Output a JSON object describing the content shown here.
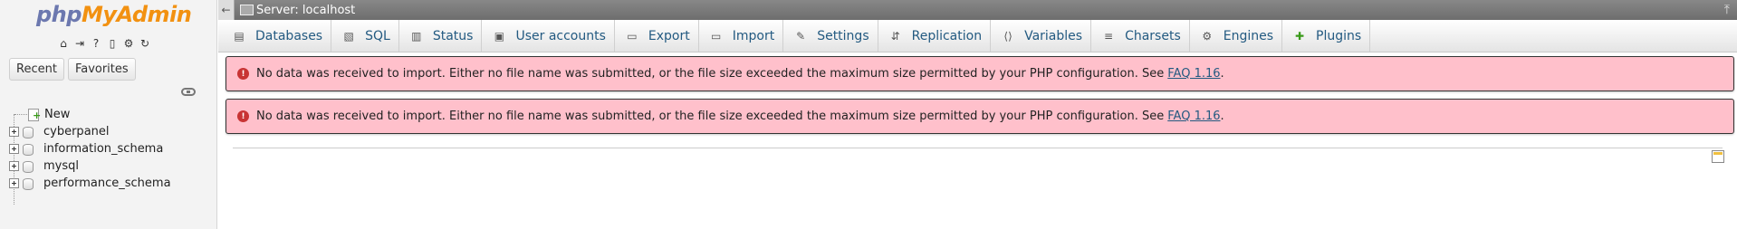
{
  "logo": {
    "php": "php",
    "my": "My",
    "admin": "Admin"
  },
  "nav_icons": [
    "home-icon",
    "logout-icon",
    "help-icon",
    "docs-icon",
    "settings-icon",
    "reload-icon"
  ],
  "nav_tabs": {
    "recent": "Recent",
    "favorites": "Favorites"
  },
  "tree": {
    "new": "New",
    "databases": [
      "cyberpanel",
      "information_schema",
      "mysql",
      "performance_schema"
    ]
  },
  "serverbar": {
    "label": "Server: localhost"
  },
  "menu": {
    "tabs": [
      {
        "label": "Databases",
        "icon": "databases-icon"
      },
      {
        "label": "SQL",
        "icon": "sql-icon"
      },
      {
        "label": "Status",
        "icon": "status-icon"
      },
      {
        "label": "User accounts",
        "icon": "user-accounts-icon"
      },
      {
        "label": "Export",
        "icon": "export-icon"
      },
      {
        "label": "Import",
        "icon": "import-icon"
      },
      {
        "label": "Settings",
        "icon": "settings-icon"
      },
      {
        "label": "Replication",
        "icon": "replication-icon"
      },
      {
        "label": "Variables",
        "icon": "variables-icon"
      },
      {
        "label": "Charsets",
        "icon": "charsets-icon"
      },
      {
        "label": "Engines",
        "icon": "engines-icon"
      },
      {
        "label": "Plugins",
        "icon": "plugins-icon"
      }
    ]
  },
  "errors": [
    {
      "text": "No data was received to import. Either no file name was submitted, or the file size exceeded the maximum size permitted by your PHP configuration. See",
      "link": "FAQ 1.16",
      "tail": "."
    },
    {
      "text": "No data was received to import. Either no file name was submitted, or the file size exceeded the maximum size permitted by your PHP configuration. See",
      "link": "FAQ 1.16",
      "tail": "."
    }
  ],
  "colors": {
    "error_bg": "#ffc0cb",
    "link": "#235a81",
    "serverbar": "#777777"
  }
}
